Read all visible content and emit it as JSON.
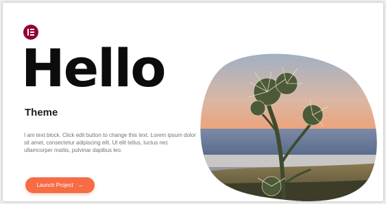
{
  "hero": {
    "title": "Hello",
    "subtitle": "Theme",
    "body": "I am text block. Click edit button to change this text. Lorem ipsum dolor sit amet, consectetur adipiscing elit. Ut elit tellus, luctus nec ullamcorper mattis, pulvinar dapibus leo.",
    "cta_label": "Launch Project",
    "cta_arrow": "→"
  },
  "colors": {
    "accent": "#f76b45",
    "logo": "#92003b",
    "title": "#0c0c0c",
    "body_text": "#727272"
  },
  "icons": {
    "logo": "elementor-logo-icon",
    "cta_arrow": "arrow-right-icon",
    "photo": "desert-thistle-plant-image"
  }
}
